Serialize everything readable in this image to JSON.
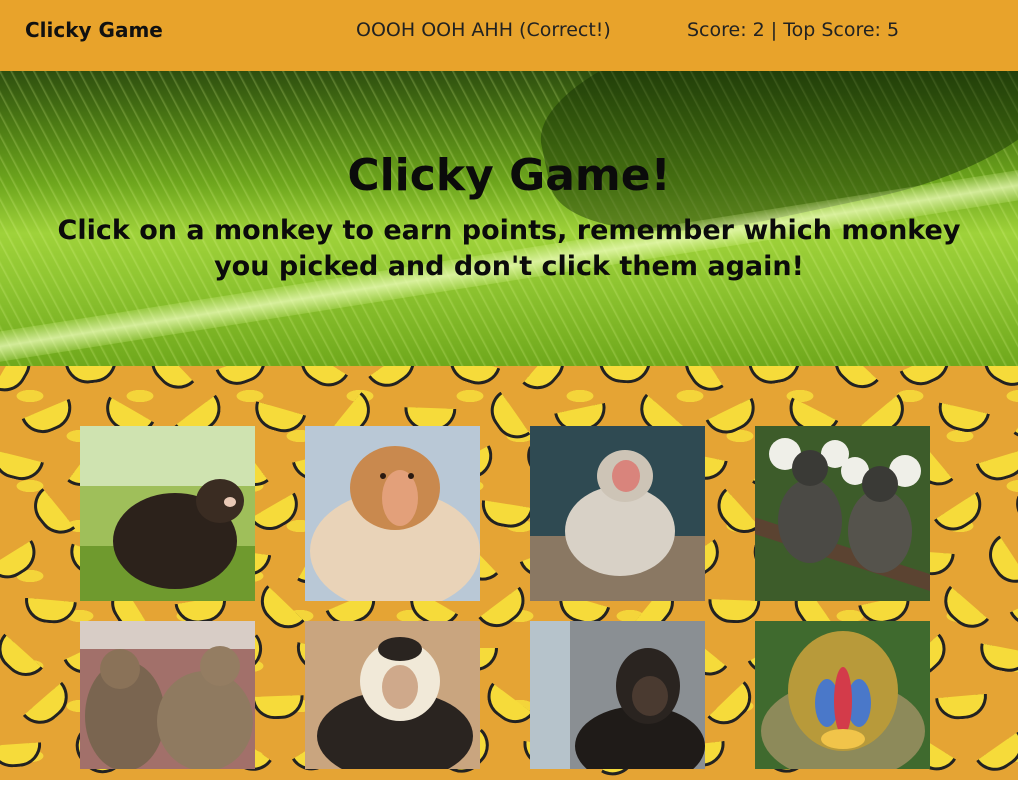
{
  "navbar": {
    "brand": "Clicky Game",
    "status": "OOOH OOH AHH (Correct!)",
    "score": "Score: 2 | Top Score: 5",
    "bg_color": "#e8a32b"
  },
  "hero": {
    "title": "Clicky Game!",
    "subtitle": "Click on a monkey to earn points, remember which monkey you picked and don't click them again!"
  },
  "game": {
    "bg_color": "#e5a434",
    "cards": [
      {
        "name": "howler-monkey-card"
      },
      {
        "name": "proboscis-monkey-card"
      },
      {
        "name": "japanese-macaque-card"
      },
      {
        "name": "marmosets-card"
      },
      {
        "name": "rhesus-macaques-card"
      },
      {
        "name": "capuchin-card"
      },
      {
        "name": "bonobo-card"
      },
      {
        "name": "mandrill-card"
      }
    ]
  }
}
